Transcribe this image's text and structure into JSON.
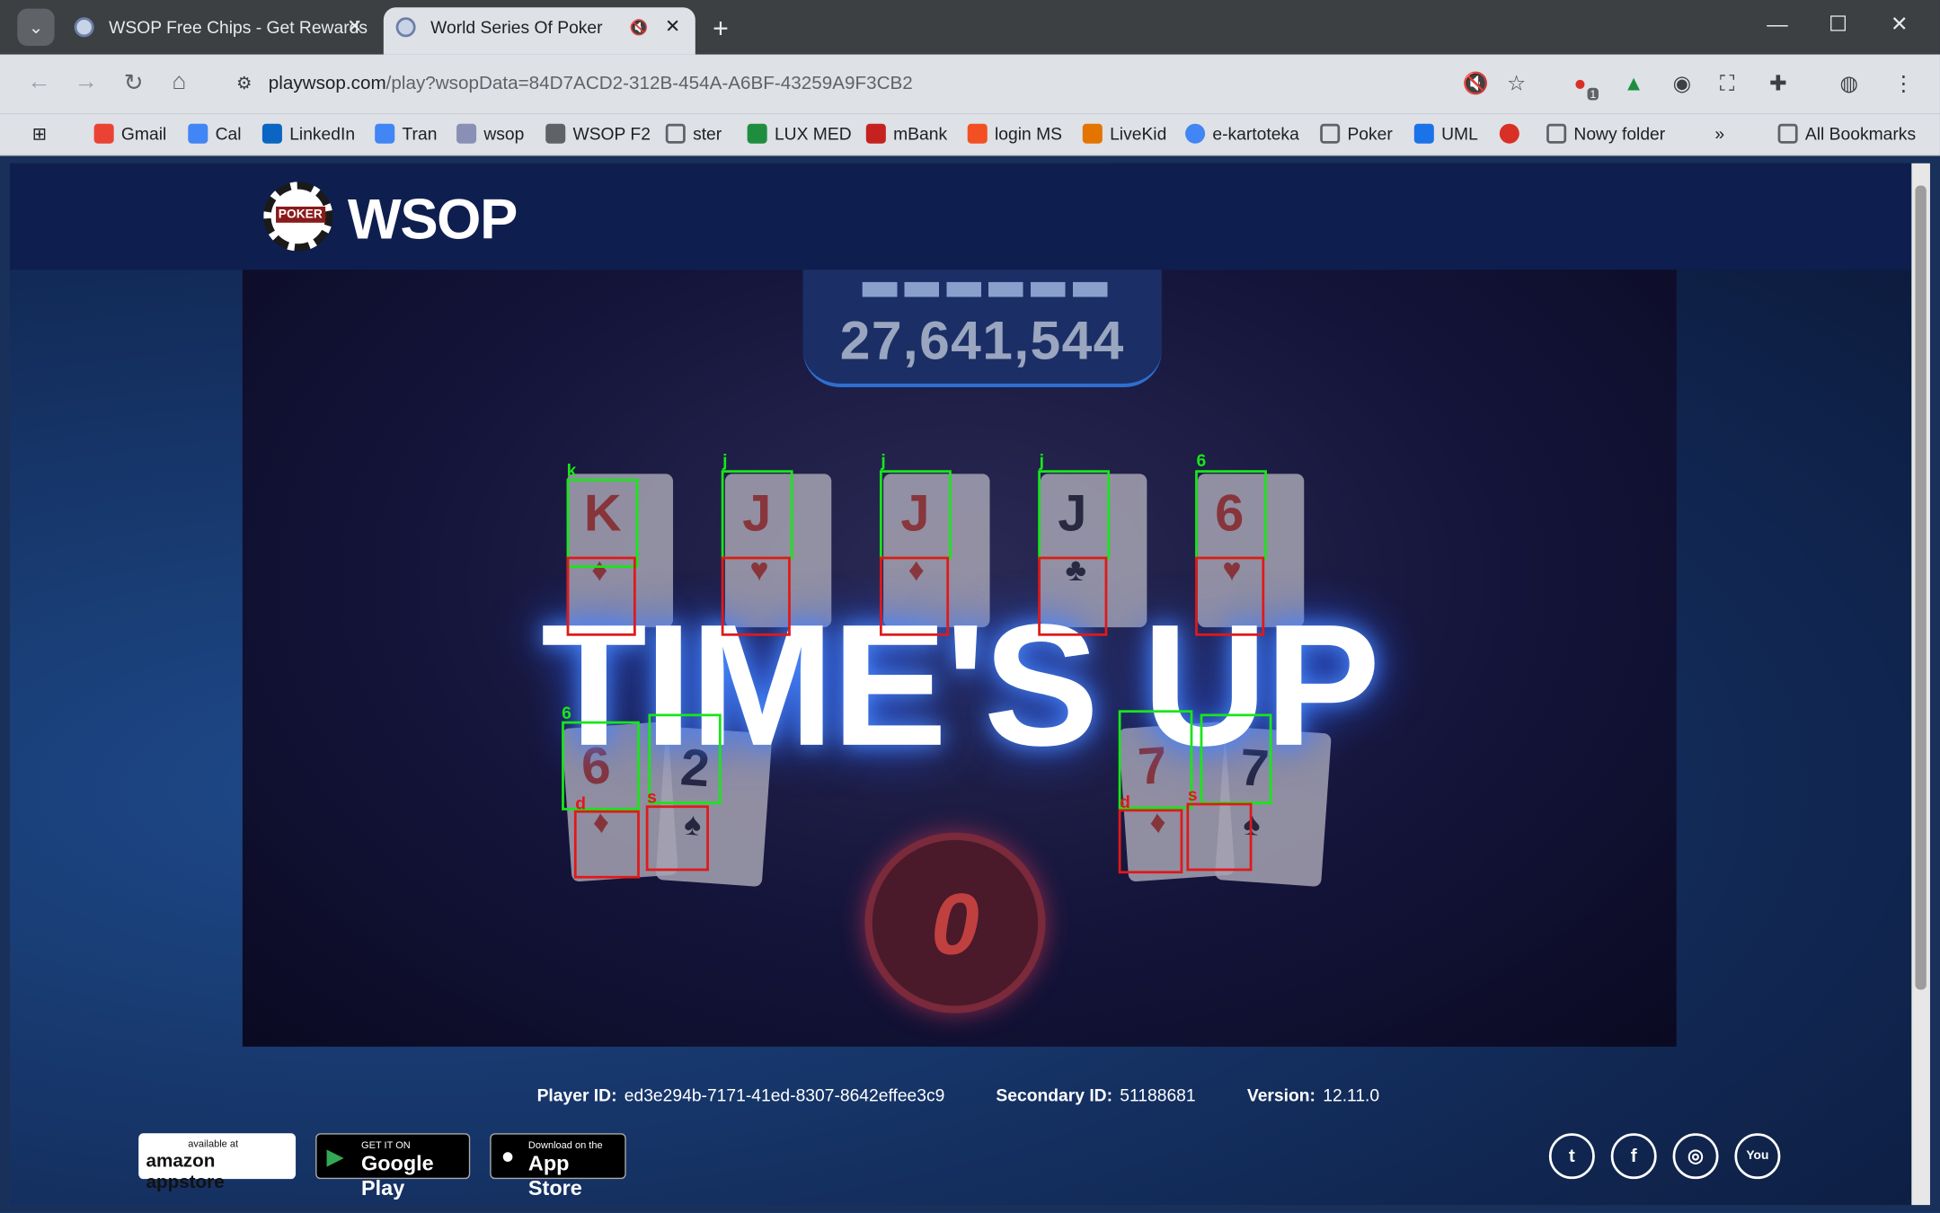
{
  "browser": {
    "tabs": [
      {
        "title": "WSOP Free Chips - Get Rewards"
      },
      {
        "title": "World Series Of Poker"
      }
    ],
    "url_host": "playwsop.com",
    "url_path": "/play?wsopData=84D7ACD2-312B-454A-A6BF-43259A9F3CB2",
    "extension_badge": "1",
    "bookmarks": [
      "Gmail",
      "Cal",
      "LinkedIn",
      "Tran",
      "wsop",
      "WSOP F2",
      "ster",
      "LUX MED",
      "mBank",
      "login MS",
      "LiveKid",
      "e-kartoteka",
      "Poker",
      "UML",
      "Nowy folder"
    ],
    "all_bookmarks": "All Bookmarks"
  },
  "site": {
    "logo_text": "WSOP",
    "chip_text": "POKER"
  },
  "game": {
    "jackpot": "27,641,544",
    "message": "TIME'S UP",
    "timer": "0",
    "cards": {
      "c1": {
        "rank": "K",
        "suit": "♦"
      },
      "c2": {
        "rank": "J",
        "suit": "♥"
      },
      "c3": {
        "rank": "J",
        "suit": "♦"
      },
      "c4": {
        "rank": "J",
        "suit": "♣"
      },
      "c5": {
        "rank": "6",
        "suit": "♥"
      },
      "h1": {
        "rank": "6",
        "suit": "♦"
      },
      "h2": {
        "rank": "2",
        "suit": "♠"
      },
      "h3": {
        "rank": "7",
        "suit": "♦"
      },
      "h4": {
        "rank": "7",
        "suit": "♠"
      }
    },
    "detections": {
      "c1_label": "k",
      "c2_label": "j",
      "c3_label": "j",
      "c4_label": "j",
      "c5_label": "6",
      "h1_label": "6",
      "h1_suit_label": "d",
      "h2_suit_label": "s",
      "h3_suit_label": "d",
      "h4_suit_label": "s"
    }
  },
  "footer": {
    "player_id_label": "Player ID:",
    "player_id": "ed3e294b-7171-41ed-8307-8642effee3c9",
    "secondary_id_label": "Secondary ID:",
    "secondary_id": "51188681",
    "version_label": "Version:",
    "version": "12.11.0",
    "stores": {
      "amazon_small": "available at",
      "amazon_big": "amazon appstore",
      "google_small": "GET IT ON",
      "google_big": "Google Play",
      "apple_small": "Download on the",
      "apple_big": "App Store"
    },
    "social": [
      "twitter",
      "facebook",
      "instagram",
      "youtube"
    ]
  }
}
